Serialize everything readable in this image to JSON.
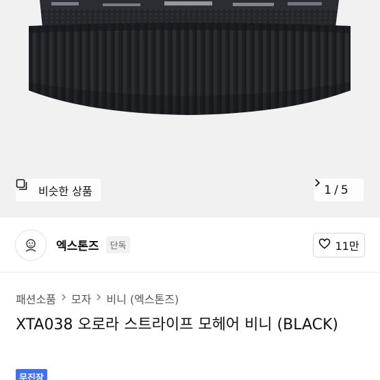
{
  "product_image": {
    "similar_label": "비슷한 상품",
    "pager": {
      "current": "1",
      "separator": "/",
      "total": "5"
    }
  },
  "seller": {
    "name": "엑스톤즈",
    "badge": "단독",
    "likes": "11만"
  },
  "breadcrumb": [
    "패션소품",
    "모자",
    "비니 (엑스톤즈)"
  ],
  "product": {
    "title": "XTA038 오로라 스트라이프 모헤어 비니 (BLACK)",
    "shipping_badge": "무진장"
  },
  "colors": {
    "accent": "#3f6fff",
    "image_bg": "#f1f1f1"
  }
}
